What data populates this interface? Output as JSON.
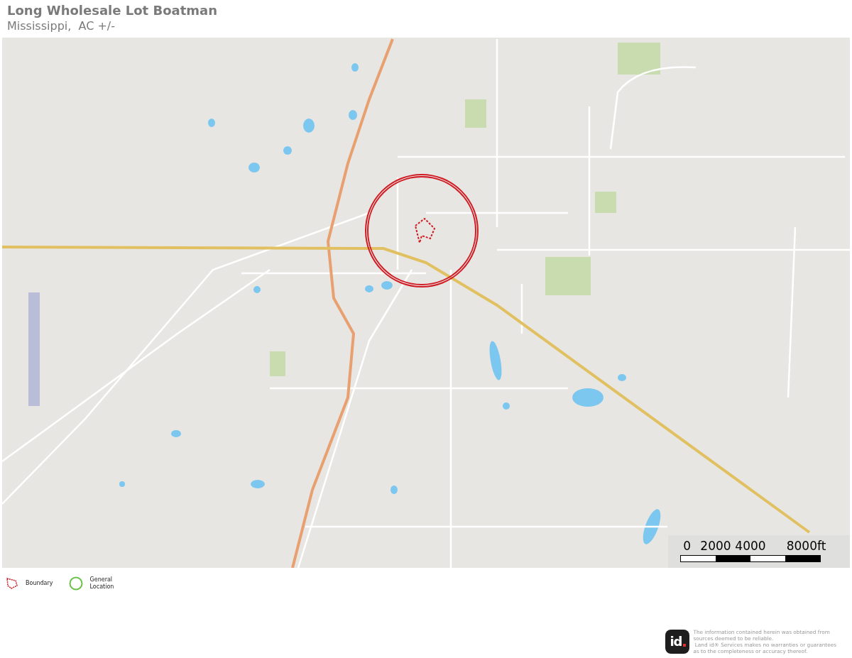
{
  "header": {
    "title": "Long Wholesale Lot Boatman",
    "subtitle": "Mississippi,  AC +/-"
  },
  "map": {
    "scale_bar": {
      "labels": [
        "0",
        "2000",
        "4000",
        "8000ft"
      ]
    }
  },
  "legend": [
    {
      "kind": "boundary",
      "label": "Boundary"
    },
    {
      "kind": "circle",
      "label": "General\nLocation"
    }
  ],
  "footer": {
    "logo": "id",
    "disclaimer": "The information contained herein was obtained from\nsources deemed to be reliable.\n Land id® Services makes no warranties or guarantees\nas to the completeness or accuracy thereof."
  }
}
